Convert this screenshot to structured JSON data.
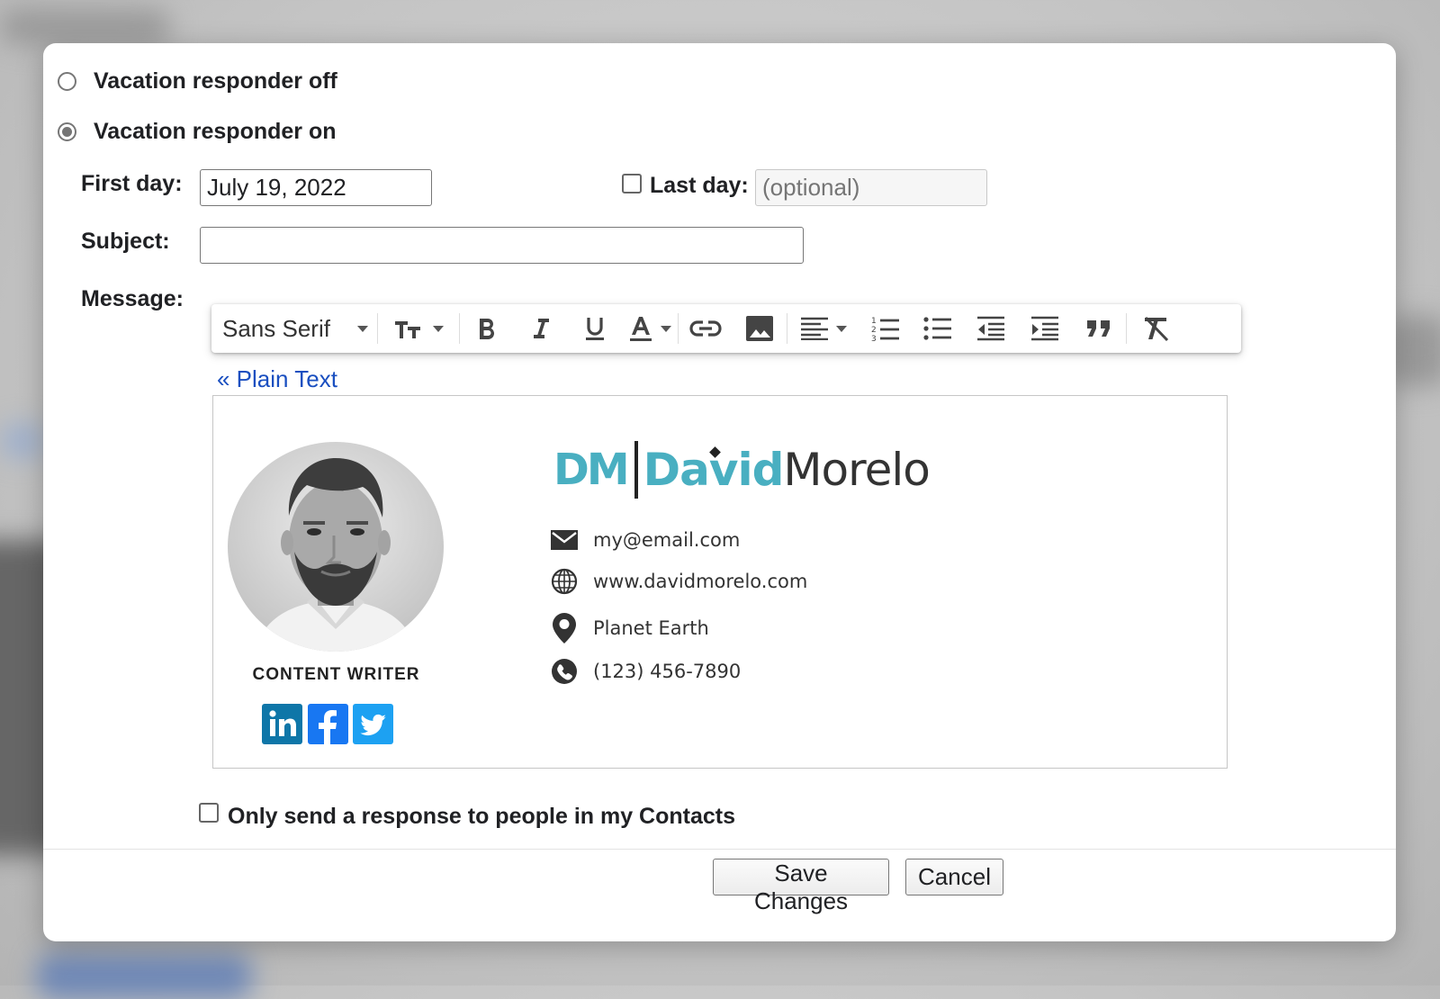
{
  "responder": {
    "off_label": "Vacation responder off",
    "on_label": "Vacation responder on"
  },
  "form": {
    "first_day_label": "First day:",
    "first_day_value": "July 19, 2022",
    "last_day_label": "Last day:",
    "last_day_placeholder": "(optional)",
    "subject_label": "Subject:",
    "subject_value": "",
    "message_label": "Message:"
  },
  "toolbar": {
    "font_family": "Sans Serif",
    "icons": [
      "font-size-icon",
      "bold-icon",
      "italic-icon",
      "underline-icon",
      "text-color-icon",
      "link-icon",
      "image-icon",
      "align-icon",
      "numbered-list-icon",
      "bulleted-list-icon",
      "indent-less-icon",
      "indent-more-icon",
      "quote-icon",
      "remove-formatting-icon"
    ]
  },
  "plain_text_link": "« Plain Text",
  "signature": {
    "logo_initials": "DM",
    "logo_first": "David",
    "logo_last": "Morelo",
    "role": "CONTENT WRITER",
    "email": "my@email.com",
    "website": "www.davidmorelo.com",
    "location": "Planet Earth",
    "phone": "(123) 456-7890",
    "accent_color": "#49afc1",
    "social": [
      {
        "icon": "linkedin-icon",
        "color": "#0e76a8"
      },
      {
        "icon": "facebook-icon",
        "color": "#3b5998"
      },
      {
        "icon": "twitter-icon",
        "color": "#1da1f2"
      }
    ]
  },
  "contacts_only_label": "Only send a response to people in my Contacts",
  "buttons": {
    "save": "Save Changes",
    "cancel": "Cancel"
  }
}
